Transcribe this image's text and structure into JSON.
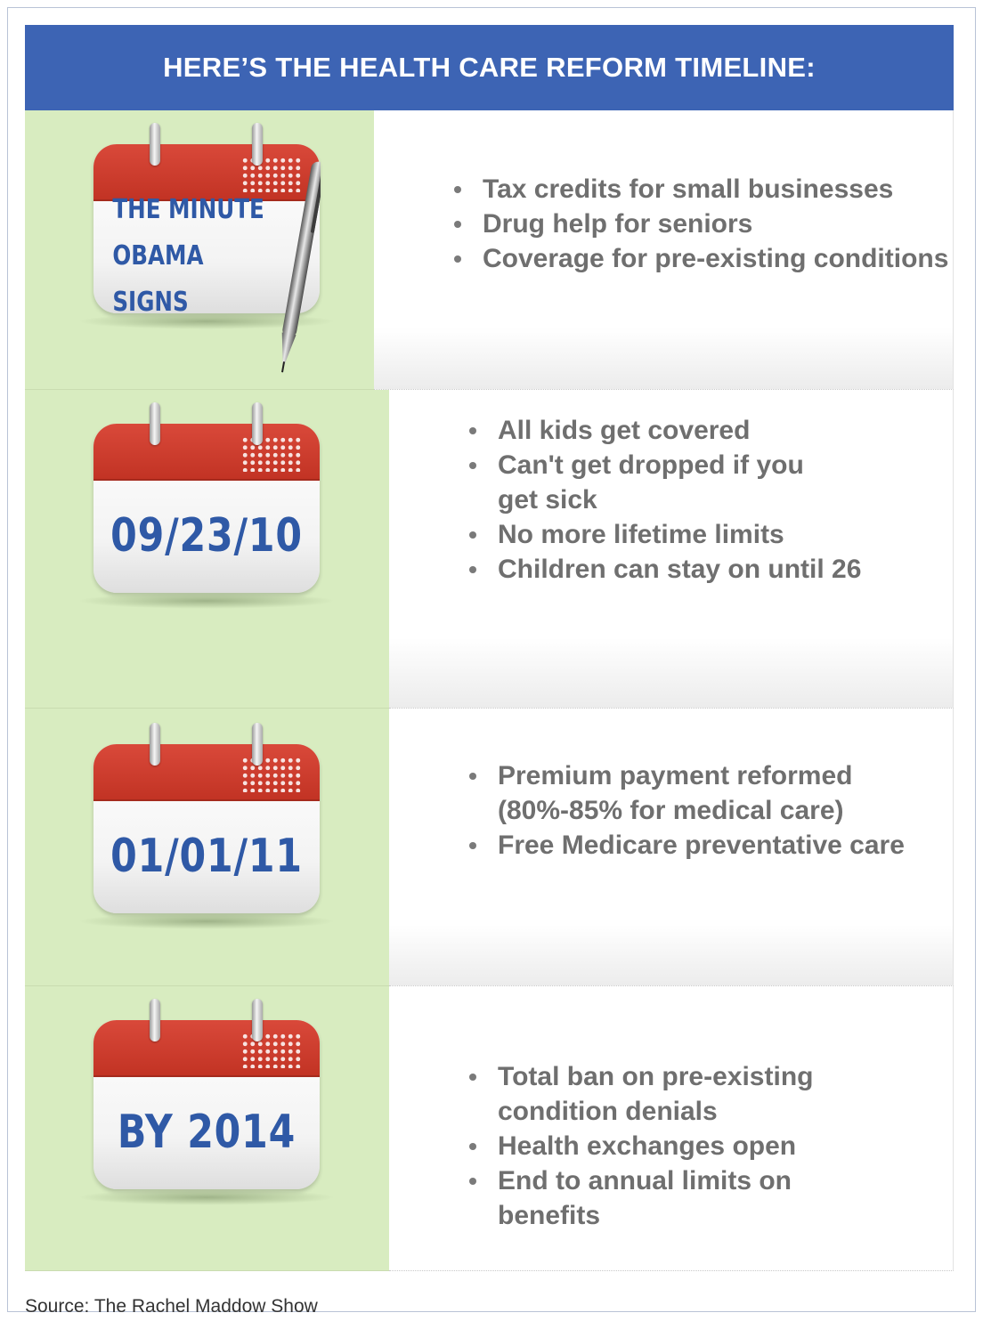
{
  "header": {
    "title": "HERE’S THE HEALTH CARE REFORM TIMELINE:"
  },
  "colors": {
    "header_blue": "#3d64b4",
    "left_green": "#d8ecc0",
    "calendar_red": "#c23324",
    "date_blue": "#2f59a6",
    "bullet_gray": "#6f6f6f"
  },
  "rows": [
    {
      "date_lines": [
        "THE MINUTE",
        "OBAMA SIGNS"
      ],
      "icon": "calendar-with-pen-icon",
      "bullets": [
        "Tax credits for small businesses",
        "Drug help for seniors",
        "Coverage for pre-existing conditions"
      ]
    },
    {
      "date": "09/23/10",
      "icon": "calendar-icon",
      "bullets": [
        "All kids get covered",
        "Can't get dropped if you get sick",
        "No more lifetime limits",
        "Children can stay on until 26"
      ]
    },
    {
      "date": "01/01/11",
      "icon": "calendar-icon",
      "bullets": [
        "Premium payment reformed (80%-85% for medical care)",
        "Free Medicare preventative care"
      ]
    },
    {
      "date": "BY 2014",
      "icon": "calendar-icon",
      "bullets": [
        "Total ban on pre-existing condition denials",
        "Health exchanges open",
        "End to annual limits on benefits"
      ]
    }
  ],
  "source": "Source: The Rachel Maddow Show"
}
